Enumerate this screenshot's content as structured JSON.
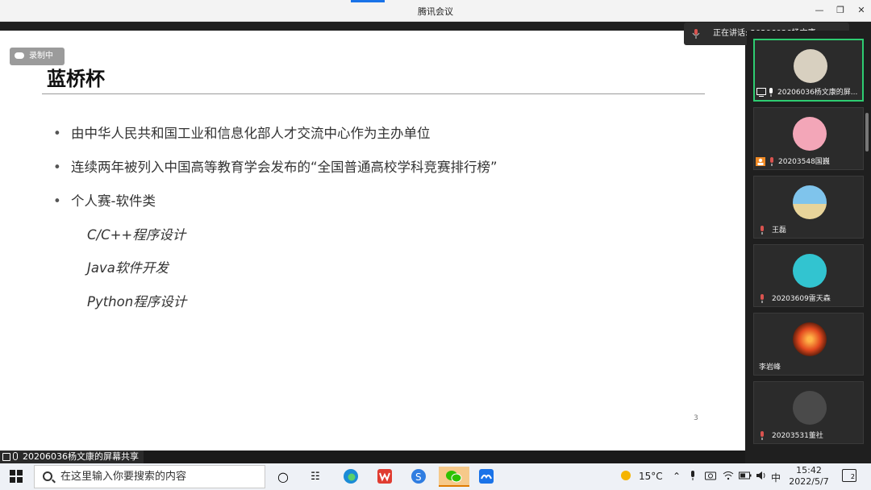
{
  "window": {
    "title": "腾讯会议"
  },
  "recording": {
    "label": "录制中"
  },
  "speaking": {
    "label": "正在讲话: 20206036杨文康"
  },
  "slide": {
    "title": "蓝桥杯",
    "bullets": [
      "由中华人民共和国工业和信息化部人才交流中心作为主办单位",
      "连续两年被列入中国高等教育学会发布的“全国普通高校学科竞赛排行榜”",
      "个人赛-软件类"
    ],
    "sub_items": [
      "C/C++程序设计",
      "Java软件开发",
      "Python程序设计"
    ],
    "page_number": "3",
    "bullet_glyph": "•"
  },
  "participants": [
    {
      "name": "20206036杨文康的屏...",
      "avatar_color": "#d8d0c0"
    },
    {
      "name": "20203548国巍",
      "avatar_color": "#f3a6b8"
    },
    {
      "name": "王磊",
      "avatar_color": "#9ed0ea"
    },
    {
      "name": "20203609雷天森",
      "avatar_color": "#32c4d0"
    },
    {
      "name": "李岩峰",
      "avatar_color": "#e2481e"
    },
    {
      "name": "20203531董社",
      "avatar_color": "#4a4a4a"
    }
  ],
  "share": {
    "label": "20206036杨文康的屏幕共享"
  },
  "taskbar": {
    "search_placeholder": "在这里输入你要搜索的内容",
    "weather": "15°C",
    "ime": "中",
    "time": "15:42",
    "date": "2022/5/7",
    "notifications": "2"
  },
  "colors": {
    "active_border": "#2ecc71",
    "accent": "#1a73e8"
  }
}
